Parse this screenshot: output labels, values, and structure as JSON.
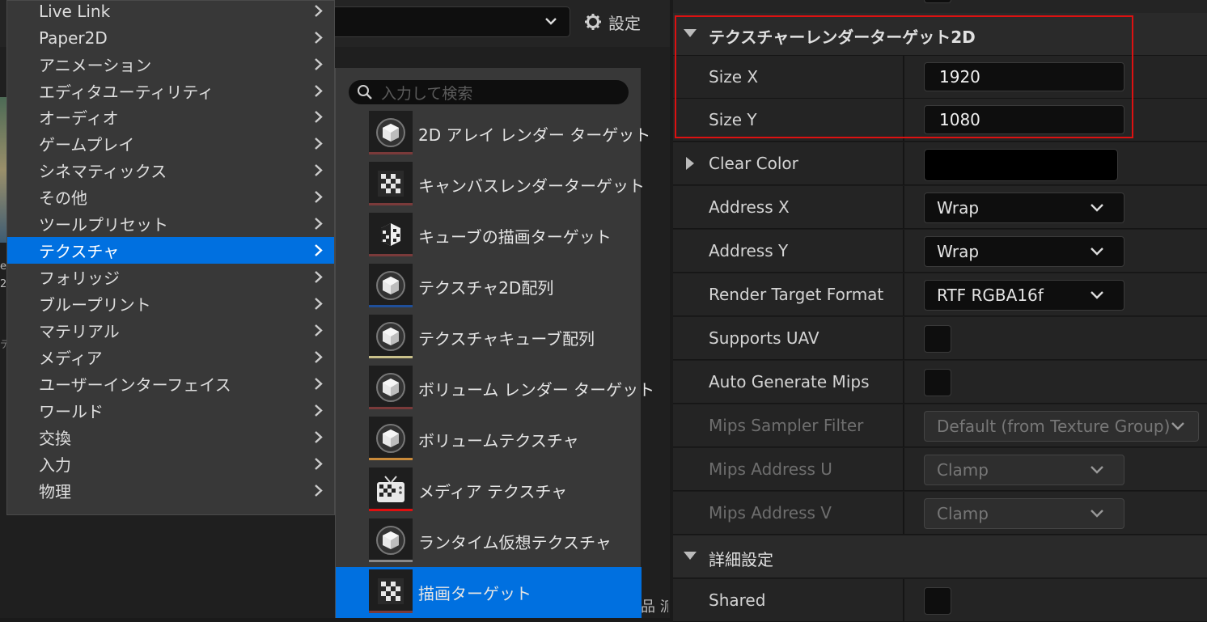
{
  "toolbar": {
    "settings_label": "設定"
  },
  "background": {
    "bottom_text": "品 派"
  },
  "main_menu": {
    "items": [
      {
        "label": "Live Link"
      },
      {
        "label": "Paper2D"
      },
      {
        "label": "アニメーション"
      },
      {
        "label": "エディタユーティリティ"
      },
      {
        "label": "オーディオ"
      },
      {
        "label": "ゲームプレイ"
      },
      {
        "label": "シネマティックス"
      },
      {
        "label": "その他"
      },
      {
        "label": "ツールプリセット"
      },
      {
        "label": "テクスチャ",
        "selected": true
      },
      {
        "label": "フォリッジ"
      },
      {
        "label": "ブループリント"
      },
      {
        "label": "マテリアル"
      },
      {
        "label": "メディア"
      },
      {
        "label": "ユーザーインターフェイス"
      },
      {
        "label": "ワールド"
      },
      {
        "label": "交換"
      },
      {
        "label": "入力"
      },
      {
        "label": "物理"
      }
    ]
  },
  "submenu": {
    "search_placeholder": "入力して検索",
    "items": [
      {
        "label": "2D アレイ レンダー ターゲット",
        "icon": "sphere-icon",
        "bar_color": "#7a3a3a"
      },
      {
        "label": "キャンバスレンダーターゲット",
        "icon": "checker-icon",
        "bar_color": "#7a3a3a"
      },
      {
        "label": "キューブの描画ターゲット",
        "icon": "cube-checker-icon",
        "bar_color": "#7a3a3a"
      },
      {
        "label": "テクスチャ2D配列",
        "icon": "sphere-icon",
        "bar_color": "#1f4f9a"
      },
      {
        "label": "テクスチャキューブ配列",
        "icon": "sphere-icon",
        "bar_color": "#c9c08a"
      },
      {
        "label": "ボリューム レンダー ターゲット",
        "icon": "sphere-icon",
        "bar_color": "#7a3a3a"
      },
      {
        "label": "ボリュームテクスチャ",
        "icon": "sphere-icon",
        "bar_color": "#c98a3a"
      },
      {
        "label": "メディア テクスチャ",
        "icon": "tv-icon",
        "bar_color": "#e01010"
      },
      {
        "label": "ランタイム仮想テクスチャ",
        "icon": "sphere-icon",
        "bar_color": "#888888"
      },
      {
        "label": "描画ターゲット",
        "icon": "checker-icon",
        "bar_color": "#7a3a3a",
        "selected": true
      }
    ]
  },
  "details": {
    "section_title": "テクスチャーレンダーターゲット2D",
    "size_x": {
      "label": "Size X",
      "value": "1920"
    },
    "size_y": {
      "label": "Size Y",
      "value": "1080"
    },
    "clear_color": {
      "label": "Clear Color",
      "value_color": "#000000"
    },
    "address_x": {
      "label": "Address X",
      "value": "Wrap"
    },
    "address_y": {
      "label": "Address Y",
      "value": "Wrap"
    },
    "render_target_format": {
      "label": "Render Target Format",
      "value": "RTF RGBA16f"
    },
    "supports_uav": {
      "label": "Supports UAV",
      "checked": false
    },
    "auto_generate_mips": {
      "label": "Auto Generate Mips",
      "checked": false
    },
    "mips_sampler_filter": {
      "label": "Mips Sampler Filter",
      "value": "Default (from Texture Group)"
    },
    "mips_address_u": {
      "label": "Mips Address U",
      "value": "Clamp"
    },
    "mips_address_v": {
      "label": "Mips Address V",
      "value": "Clamp"
    },
    "advanced_section": "詳細設定",
    "shared": {
      "label": "Shared",
      "checked": false
    }
  },
  "colors": {
    "selection": "#0070e0",
    "highlight_border": "#dd1111"
  }
}
